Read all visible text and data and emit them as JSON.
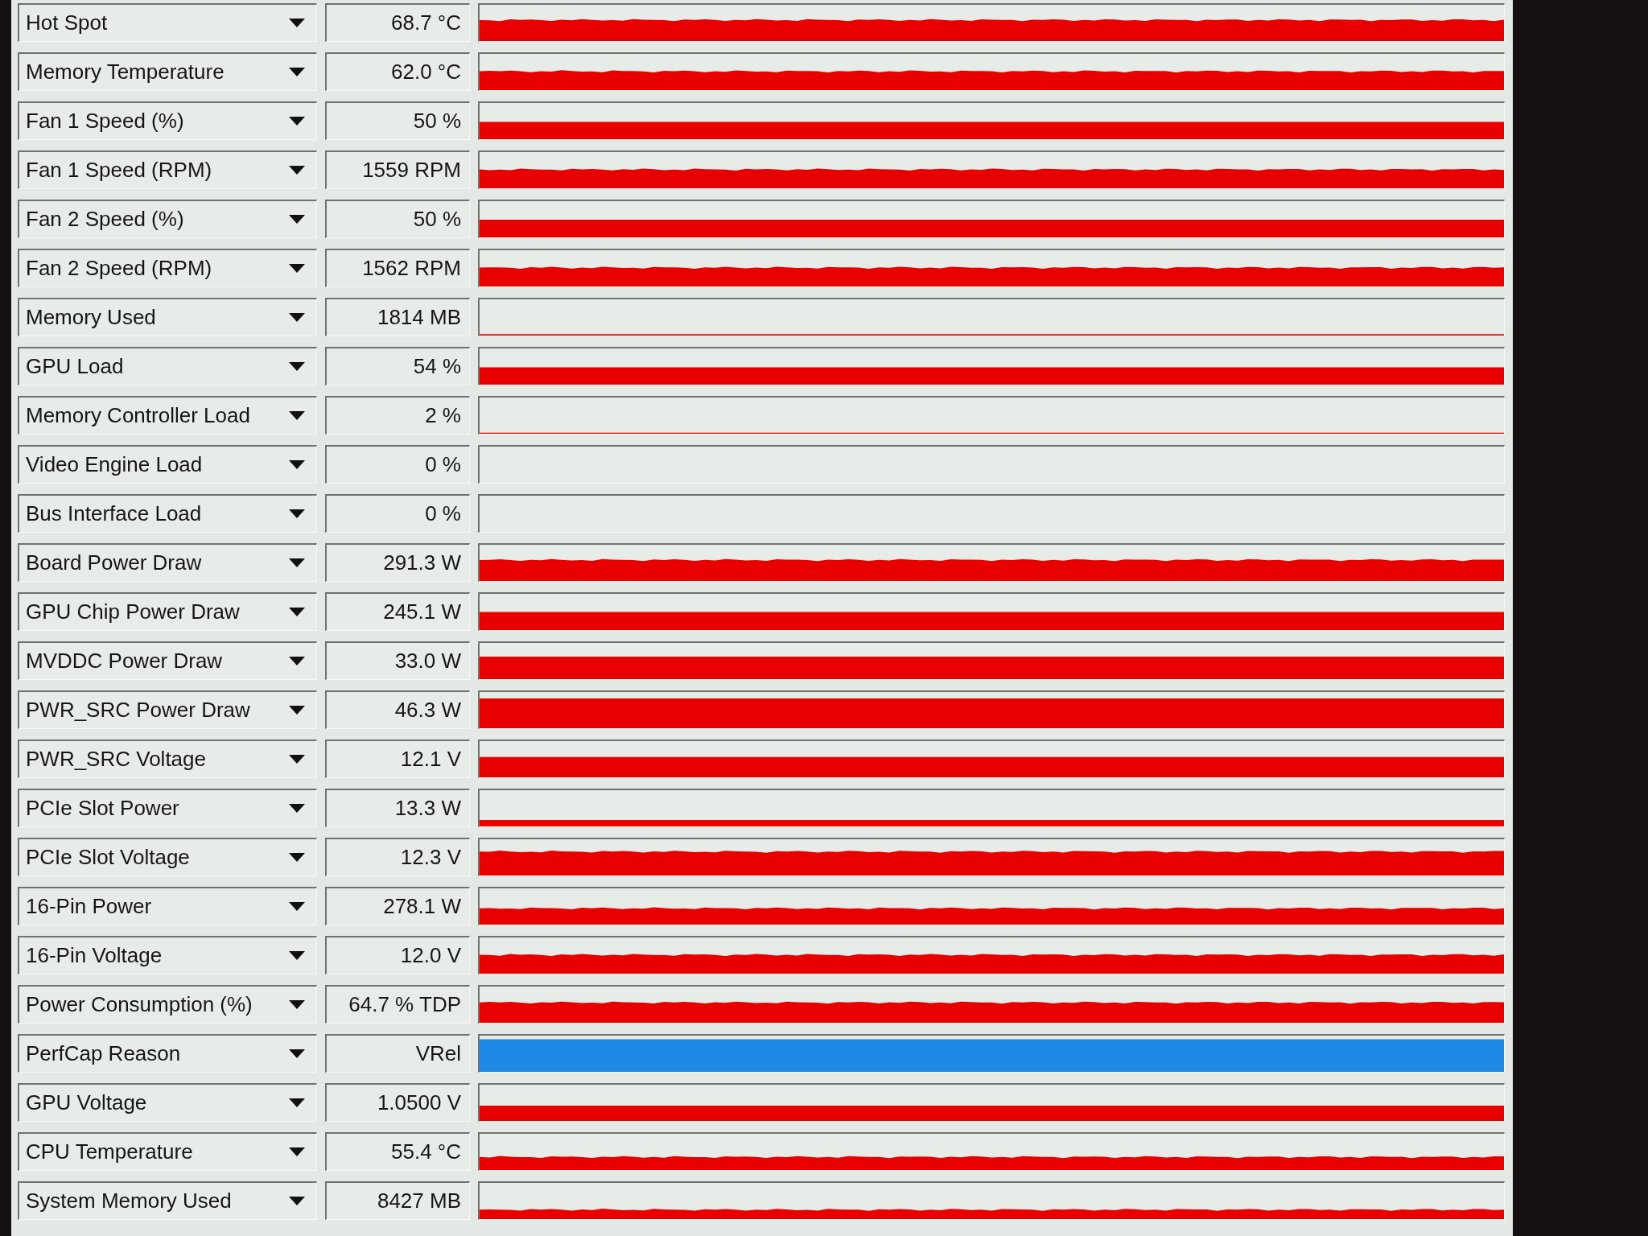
{
  "rows": [
    {
      "label": "Hot Spot",
      "value": "68.7 °C",
      "color": "#e80000"
    },
    {
      "label": "Memory Temperature",
      "value": "62.0 °C",
      "color": "#e80000"
    },
    {
      "label": "Fan 1 Speed (%)",
      "value": "50 %",
      "color": "#e80000"
    },
    {
      "label": "Fan 1 Speed (RPM)",
      "value": "1559 RPM",
      "color": "#e80000"
    },
    {
      "label": "Fan 2 Speed (%)",
      "value": "50 %",
      "color": "#e80000"
    },
    {
      "label": "Fan 2 Speed (RPM)",
      "value": "1562 RPM",
      "color": "#e80000"
    },
    {
      "label": "Memory Used",
      "value": "1814 MB",
      "color": "#e80000"
    },
    {
      "label": "GPU Load",
      "value": "54 %",
      "color": "#e80000"
    },
    {
      "label": "Memory Controller Load",
      "value": "2 %",
      "color": "#e80000"
    },
    {
      "label": "Video Engine Load",
      "value": "0 %"
    },
    {
      "label": "Bus Interface Load",
      "value": "0 %"
    },
    {
      "label": "Board Power Draw",
      "value": "291.3 W",
      "color": "#e80000"
    },
    {
      "label": "GPU Chip Power Draw",
      "value": "245.1 W",
      "color": "#e80000"
    },
    {
      "label": "MVDDC Power Draw",
      "value": "33.0 W",
      "color": "#e80000"
    },
    {
      "label": "PWR_SRC Power Draw",
      "value": "46.3 W",
      "color": "#e80000"
    },
    {
      "label": "PWR_SRC Voltage",
      "value": "12.1 V",
      "color": "#e80000"
    },
    {
      "label": "PCIe Slot Power",
      "value": "13.3 W",
      "color": "#e80000"
    },
    {
      "label": "PCIe Slot Voltage",
      "value": "12.3 V",
      "color": "#e80000"
    },
    {
      "label": "16-Pin Power",
      "value": "278.1 W",
      "color": "#e80000"
    },
    {
      "label": "16-Pin Voltage",
      "value": "12.0 V",
      "color": "#e80000"
    },
    {
      "label": "Power Consumption (%)",
      "value": "64.7 % TDP",
      "color": "#e80000"
    },
    {
      "label": "PerfCap Reason",
      "value": "VRel",
      "color": "#1e8ae6"
    },
    {
      "label": "GPU Voltage",
      "value": "1.0500 V",
      "color": "#e80000"
    },
    {
      "label": "CPU Temperature",
      "value": "55.4 °C",
      "color": "#e80000"
    },
    {
      "label": "System Memory Used",
      "value": "8427 MB",
      "color": "#e80000"
    }
  ]
}
